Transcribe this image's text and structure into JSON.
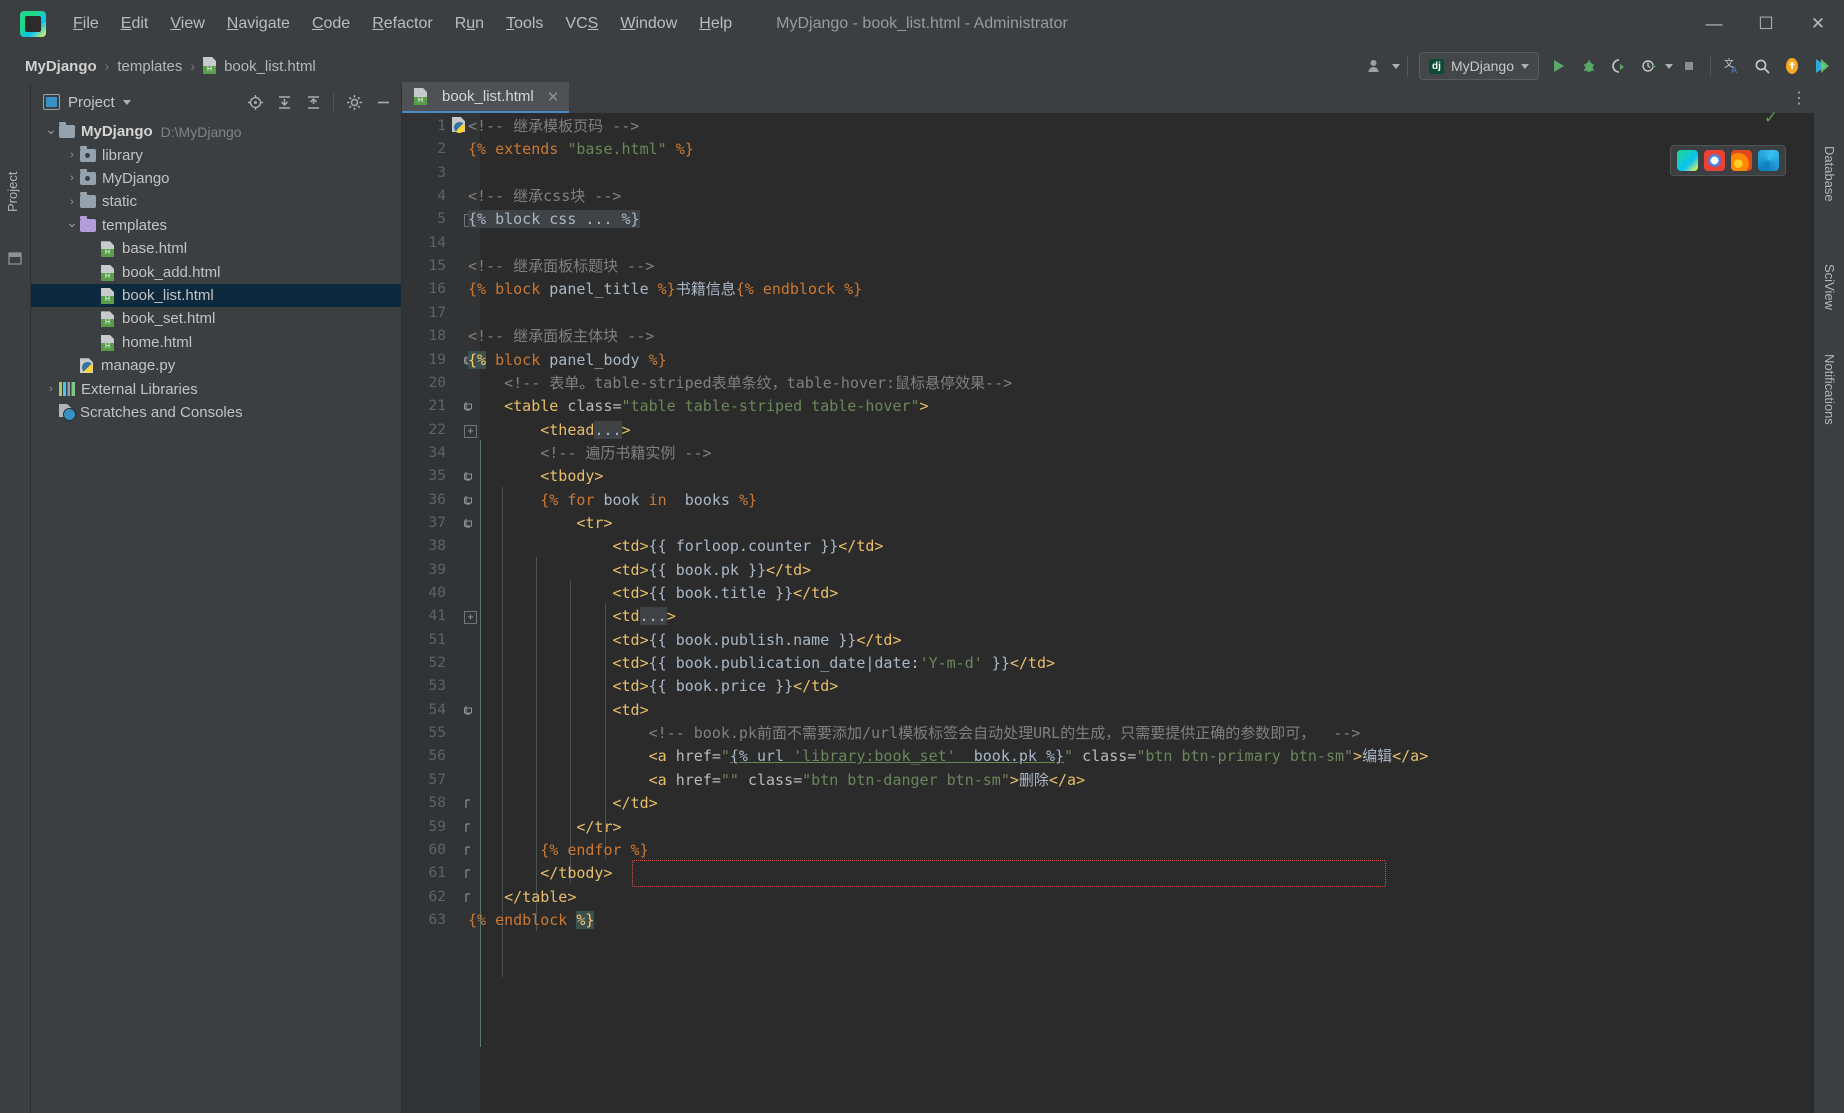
{
  "window": {
    "title": "MyDjango - book_list.html - Administrator",
    "minimize": "—",
    "maximize": "☐",
    "close": "✕"
  },
  "menu": [
    {
      "label": "File"
    },
    {
      "label": "Edit"
    },
    {
      "label": "View"
    },
    {
      "label": "Navigate"
    },
    {
      "label": "Code"
    },
    {
      "label": "Refactor"
    },
    {
      "label": "Run"
    },
    {
      "label": "Tools"
    },
    {
      "label": "VCS"
    },
    {
      "label": "Window"
    },
    {
      "label": "Help"
    }
  ],
  "breadcrumb": {
    "project": "MyDjango",
    "sep1": "›",
    "folder": "templates",
    "sep2": "›",
    "file": "book_list.html"
  },
  "toolbar": {
    "run_config": "MyDjango",
    "run_config_icon": "django-icon",
    "profile_icon": "user-profile-icon",
    "run_icon": "run-icon",
    "debug_icon": "debug-icon",
    "run_coverage_icon": "run-with-coverage-icon",
    "profiler_icon": "profiler-icon",
    "stop_icon": "stop-icon",
    "translate_icon": "translate-icon",
    "search_icon": "search-everywhere-icon",
    "update_icon": "update-project-icon",
    "share_icon": "share-icon"
  },
  "left_strip": {
    "project_label": "Project",
    "structure_icon": "structure-icon"
  },
  "right_strip": {
    "items": [
      "Database",
      "SciView",
      "Notifications"
    ]
  },
  "project_panel": {
    "title": "Project",
    "dropdown_icon": "chevron-down-icon",
    "actions": [
      {
        "name": "locate-file-icon",
        "glyph": "⊕"
      },
      {
        "name": "expand-all-icon",
        "glyph": "⤓"
      },
      {
        "name": "collapse-all-icon",
        "glyph": "⤒"
      },
      {
        "name": "settings-gear-icon",
        "glyph": "⚙"
      },
      {
        "name": "hide-panel-icon",
        "glyph": "—"
      }
    ],
    "tree": [
      {
        "label": "MyDjango",
        "path": "D:\\MyDjango",
        "icon": "folder-icon",
        "indent": 0,
        "arrow": "down",
        "bold": true,
        "selected": false
      },
      {
        "label": "library",
        "path": "",
        "icon": "source-folder-icon",
        "indent": 1,
        "arrow": "right",
        "bold": false,
        "selected": false
      },
      {
        "label": "MyDjango",
        "path": "",
        "icon": "source-folder-icon",
        "indent": 1,
        "arrow": "right",
        "bold": false,
        "selected": false
      },
      {
        "label": "static",
        "path": "",
        "icon": "folder-icon",
        "indent": 1,
        "arrow": "right",
        "bold": false,
        "selected": false
      },
      {
        "label": "templates",
        "path": "",
        "icon": "template-folder-icon",
        "indent": 1,
        "arrow": "down",
        "bold": false,
        "selected": false
      },
      {
        "label": "base.html",
        "path": "",
        "icon": "html-file-icon",
        "indent": 2,
        "arrow": "none",
        "bold": false,
        "selected": false
      },
      {
        "label": "book_add.html",
        "path": "",
        "icon": "html-file-icon",
        "indent": 2,
        "arrow": "none",
        "bold": false,
        "selected": false
      },
      {
        "label": "book_list.html",
        "path": "",
        "icon": "html-file-icon",
        "indent": 2,
        "arrow": "none",
        "bold": false,
        "selected": true
      },
      {
        "label": "book_set.html",
        "path": "",
        "icon": "html-file-icon",
        "indent": 2,
        "arrow": "none",
        "bold": false,
        "selected": false
      },
      {
        "label": "home.html",
        "path": "",
        "icon": "html-file-icon",
        "indent": 2,
        "arrow": "none",
        "bold": false,
        "selected": false
      },
      {
        "label": "manage.py",
        "path": "",
        "icon": "python-file-icon",
        "indent": 1,
        "arrow": "none",
        "bold": false,
        "selected": false
      },
      {
        "label": "External Libraries",
        "path": "",
        "icon": "external-libraries-icon",
        "indent": 0,
        "arrow": "right",
        "bold": false,
        "selected": false
      },
      {
        "label": "Scratches and Consoles",
        "path": "",
        "icon": "scratches-icon",
        "indent": 0,
        "arrow": "none",
        "bold": false,
        "selected": false
      }
    ]
  },
  "editor": {
    "tab": {
      "label": "book_list.html",
      "icon": "html-file-icon",
      "close": "✕"
    },
    "tab_overflow_icon": "more-options-icon",
    "inspection_status": "✓",
    "floating_browsers": [
      "pycharm-preview-icon",
      "chrome-icon",
      "firefox-icon",
      "edge-icon"
    ],
    "lines": [
      {
        "num": "1",
        "fold": "",
        "segs": [
          {
            "t": "<!-- 继承模板页码 -->",
            "c": "c-com"
          }
        ]
      },
      {
        "num": "2",
        "fold": "",
        "segs": [
          {
            "t": "{% ",
            "c": "c-kw"
          },
          {
            "t": "extends ",
            "c": "c-kw"
          },
          {
            "t": "\"base.html\"",
            "c": "c-str"
          },
          {
            "t": " %}",
            "c": "c-kw"
          }
        ]
      },
      {
        "num": "3",
        "fold": "",
        "segs": []
      },
      {
        "num": "4",
        "fold": "",
        "segs": [
          {
            "t": "<!-- 继承css块 -->",
            "c": "c-com"
          }
        ]
      },
      {
        "num": "5",
        "fold": "plus",
        "segs": [
          {
            "t": "{% block css ... %}",
            "c": "hl-fold"
          }
        ]
      },
      {
        "num": "14",
        "fold": "",
        "segs": []
      },
      {
        "num": "15",
        "fold": "",
        "segs": [
          {
            "t": "<!-- 继承面板标题块 -->",
            "c": "c-com"
          }
        ]
      },
      {
        "num": "16",
        "fold": "",
        "segs": [
          {
            "t": "{% ",
            "c": "c-kw"
          },
          {
            "t": "block",
            "c": "c-kw"
          },
          {
            "t": " panel_title ",
            "c": "c-plain"
          },
          {
            "t": "%}",
            "c": "c-kw"
          },
          {
            "t": "书籍信息",
            "c": "c-txt"
          },
          {
            "t": "{% ",
            "c": "c-kw"
          },
          {
            "t": "endblock",
            "c": "c-kw"
          },
          {
            "t": " %}",
            "c": "c-kw"
          }
        ]
      },
      {
        "num": "17",
        "fold": "",
        "segs": []
      },
      {
        "num": "18",
        "fold": "",
        "segs": [
          {
            "t": "<!-- 继承面板主体块 -->",
            "c": "c-com"
          }
        ]
      },
      {
        "num": "19",
        "fold": "open",
        "segs": [
          {
            "t": "{%",
            "c": "hl-brace"
          },
          {
            "t": " ",
            "c": "c-plain"
          },
          {
            "t": "block",
            "c": "c-kw"
          },
          {
            "t": " panel_body ",
            "c": "c-plain"
          },
          {
            "t": "%}",
            "c": "c-kw"
          }
        ]
      },
      {
        "num": "20",
        "fold": "",
        "segs": [
          {
            "t": "    <!-- 表单。table-striped表单条纹，table-hover:鼠标悬停效果-->",
            "c": "c-com"
          }
        ]
      },
      {
        "num": "21",
        "fold": "open",
        "segs": [
          {
            "t": "    ",
            "c": "c-plain"
          },
          {
            "t": "<table ",
            "c": "c-tag"
          },
          {
            "t": "class=",
            "c": "c-attr"
          },
          {
            "t": "\"table table-striped table-hover\"",
            "c": "c-str"
          },
          {
            "t": ">",
            "c": "c-tag"
          }
        ]
      },
      {
        "num": "22",
        "fold": "plus",
        "segs": [
          {
            "t": "        ",
            "c": "c-plain"
          },
          {
            "t": "<thead",
            "c": "c-tag"
          },
          {
            "t": "...",
            "c": "hl-fold"
          },
          {
            "t": ">",
            "c": "c-tag"
          }
        ]
      },
      {
        "num": "34",
        "fold": "",
        "segs": [
          {
            "t": "        <!-- 遍历书籍实例 -->",
            "c": "c-com"
          }
        ]
      },
      {
        "num": "35",
        "fold": "open",
        "segs": [
          {
            "t": "        ",
            "c": "c-plain"
          },
          {
            "t": "<tbody>",
            "c": "c-tag"
          }
        ]
      },
      {
        "num": "36",
        "fold": "open",
        "segs": [
          {
            "t": "        ",
            "c": "c-plain"
          },
          {
            "t": "{% ",
            "c": "c-kw"
          },
          {
            "t": "for",
            "c": "c-kw"
          },
          {
            "t": " book ",
            "c": "c-plain"
          },
          {
            "t": "in",
            "c": "c-kw"
          },
          {
            "t": "  books ",
            "c": "c-plain"
          },
          {
            "t": "%}",
            "c": "c-kw"
          }
        ]
      },
      {
        "num": "37",
        "fold": "open",
        "segs": [
          {
            "t": "            ",
            "c": "c-plain"
          },
          {
            "t": "<tr>",
            "c": "c-tag"
          }
        ]
      },
      {
        "num": "38",
        "fold": "",
        "segs": [
          {
            "t": "                ",
            "c": "c-plain"
          },
          {
            "t": "<td>",
            "c": "c-tag"
          },
          {
            "t": "{{ forloop.counter }}",
            "c": "c-plain"
          },
          {
            "t": "</td>",
            "c": "c-tag"
          }
        ]
      },
      {
        "num": "39",
        "fold": "",
        "segs": [
          {
            "t": "                ",
            "c": "c-plain"
          },
          {
            "t": "<td>",
            "c": "c-tag"
          },
          {
            "t": "{{ book.pk }}",
            "c": "c-plain"
          },
          {
            "t": "</td>",
            "c": "c-tag"
          }
        ]
      },
      {
        "num": "40",
        "fold": "",
        "segs": [
          {
            "t": "                ",
            "c": "c-plain"
          },
          {
            "t": "<td>",
            "c": "c-tag"
          },
          {
            "t": "{{ book.title }}",
            "c": "c-plain"
          },
          {
            "t": "</td>",
            "c": "c-tag"
          }
        ]
      },
      {
        "num": "41",
        "fold": "plus",
        "segs": [
          {
            "t": "                ",
            "c": "c-plain"
          },
          {
            "t": "<td",
            "c": "c-tag"
          },
          {
            "t": "...",
            "c": "hl-fold"
          },
          {
            "t": ">",
            "c": "c-tag"
          }
        ]
      },
      {
        "num": "51",
        "fold": "",
        "segs": [
          {
            "t": "                ",
            "c": "c-plain"
          },
          {
            "t": "<td>",
            "c": "c-tag"
          },
          {
            "t": "{{ book.publish.name }}",
            "c": "c-plain"
          },
          {
            "t": "</td>",
            "c": "c-tag"
          }
        ]
      },
      {
        "num": "52",
        "fold": "",
        "segs": [
          {
            "t": "                ",
            "c": "c-plain"
          },
          {
            "t": "<td>",
            "c": "c-tag"
          },
          {
            "t": "{{ book.publication_date|date:",
            "c": "c-plain"
          },
          {
            "t": "'Y-m-d'",
            "c": "c-str"
          },
          {
            "t": " }}",
            "c": "c-plain"
          },
          {
            "t": "</td>",
            "c": "c-tag"
          }
        ]
      },
      {
        "num": "53",
        "fold": "",
        "segs": [
          {
            "t": "                ",
            "c": "c-plain"
          },
          {
            "t": "<td>",
            "c": "c-tag"
          },
          {
            "t": "{{ book.price }}",
            "c": "c-plain"
          },
          {
            "t": "</td>",
            "c": "c-tag"
          }
        ]
      },
      {
        "num": "54",
        "fold": "open",
        "segs": [
          {
            "t": "                ",
            "c": "c-plain"
          },
          {
            "t": "<td>",
            "c": "c-tag"
          }
        ]
      },
      {
        "num": "55",
        "fold": "",
        "segs": [
          {
            "t": "                    <!-- book.pk前面不需要添加/url模板标签会自动处理URL的生成，只需要提供正确的参数即可，  -->",
            "c": "c-com"
          }
        ]
      },
      {
        "num": "56",
        "fold": "",
        "segs": [
          {
            "t": "                    ",
            "c": "c-plain"
          },
          {
            "t": "<a ",
            "c": "c-tag"
          },
          {
            "t": "href=",
            "c": "c-attr"
          },
          {
            "t": "\"",
            "c": "c-str"
          },
          {
            "t": "{% url ",
            "c": "urlunder c-plain"
          },
          {
            "t": "'library:book_set'",
            "c": "urlunder c-str"
          },
          {
            "t": "  book.pk %}",
            "c": "urlunder c-plain"
          },
          {
            "t": "\"",
            "c": "c-str"
          },
          {
            "t": " class=",
            "c": "c-attr"
          },
          {
            "t": "\"btn btn-primary btn-sm\"",
            "c": "c-str"
          },
          {
            "t": ">",
            "c": "c-tag"
          },
          {
            "t": "编辑",
            "c": "c-txt"
          },
          {
            "t": "</a>",
            "c": "c-tag"
          }
        ]
      },
      {
        "num": "57",
        "fold": "",
        "segs": [
          {
            "t": "                    ",
            "c": "c-plain"
          },
          {
            "t": "<a ",
            "c": "c-tag"
          },
          {
            "t": "href=",
            "c": "c-attr"
          },
          {
            "t": "\"\"",
            "c": "c-str"
          },
          {
            "t": " class=",
            "c": "c-attr"
          },
          {
            "t": "\"btn btn-danger btn-sm\"",
            "c": "c-str"
          },
          {
            "t": ">",
            "c": "c-tag"
          },
          {
            "t": "删除",
            "c": "c-txt"
          },
          {
            "t": "</a>",
            "c": "c-tag"
          }
        ]
      },
      {
        "num": "58",
        "fold": "closeb",
        "segs": [
          {
            "t": "                ",
            "c": "c-plain"
          },
          {
            "t": "</td>",
            "c": "c-tag"
          }
        ]
      },
      {
        "num": "59",
        "fold": "closeb",
        "segs": [
          {
            "t": "            ",
            "c": "c-plain"
          },
          {
            "t": "</tr>",
            "c": "c-tag"
          }
        ]
      },
      {
        "num": "60",
        "fold": "closeb",
        "segs": [
          {
            "t": "        ",
            "c": "c-plain"
          },
          {
            "t": "{% ",
            "c": "c-kw"
          },
          {
            "t": "endfor",
            "c": "c-kw"
          },
          {
            "t": " %}",
            "c": "c-kw"
          }
        ]
      },
      {
        "num": "61",
        "fold": "closeb",
        "segs": [
          {
            "t": "        ",
            "c": "c-plain"
          },
          {
            "t": "</tbody>",
            "c": "c-tag"
          }
        ]
      },
      {
        "num": "62",
        "fold": "closeb",
        "segs": [
          {
            "t": "    ",
            "c": "c-plain"
          },
          {
            "t": "</table>",
            "c": "c-tag"
          }
        ]
      },
      {
        "num": "63",
        "fold": "",
        "segs": [
          {
            "t": "{% ",
            "c": "c-kw"
          },
          {
            "t": "endblock",
            "c": "c-kw"
          },
          {
            "t": " ",
            "c": "c-plain"
          },
          {
            "t": "%}",
            "c": "hl-brace"
          }
        ]
      }
    ]
  },
  "colors": {
    "accent_blue": "#4a88c7",
    "error_red": "#e05252",
    "tag_orange": "#e8bf6a",
    "string_green": "#6a8759",
    "keyword_orange": "#cc7832",
    "comment_gray": "#808080",
    "selection_blue": "#0d293e",
    "editor_bg": "#2b2b2b",
    "panel_bg": "#3c3f41"
  }
}
